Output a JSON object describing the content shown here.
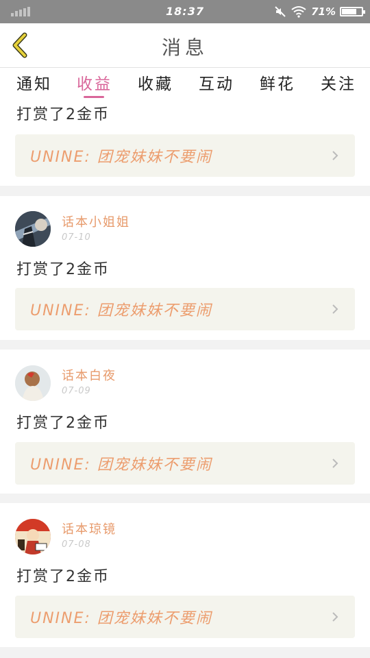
{
  "status_bar": {
    "time": "18:37",
    "battery": "71%"
  },
  "header": {
    "title": "消息"
  },
  "tabs": [
    {
      "label": "通知"
    },
    {
      "label": "收益",
      "active": true
    },
    {
      "label": "收藏"
    },
    {
      "label": "互动"
    },
    {
      "label": "鲜花"
    },
    {
      "label": "关注"
    }
  ],
  "partial_item": {
    "message": "打赏了2金币",
    "quote": "UNINE: 团宠妹妹不要闹"
  },
  "items": [
    {
      "name": "话本小姐姐",
      "date": "07-10",
      "message": "打赏了2金币",
      "quote": "UNINE: 团宠妹妹不要闹"
    },
    {
      "name": "话本白夜",
      "date": "07-09",
      "message": "打赏了2金币",
      "quote": "UNINE: 团宠妹妹不要闹"
    },
    {
      "name": "话本琼镜",
      "date": "07-08",
      "message": "打赏了2金币",
      "quote": "UNINE: 团宠妹妹不要闹"
    }
  ],
  "colors": {
    "accent": "#d9669a",
    "name": "#e79a6b",
    "quote_text": "#ec9d6e",
    "quote_bg": "#f4f4ed",
    "back_arrow": "#e6d13a"
  }
}
